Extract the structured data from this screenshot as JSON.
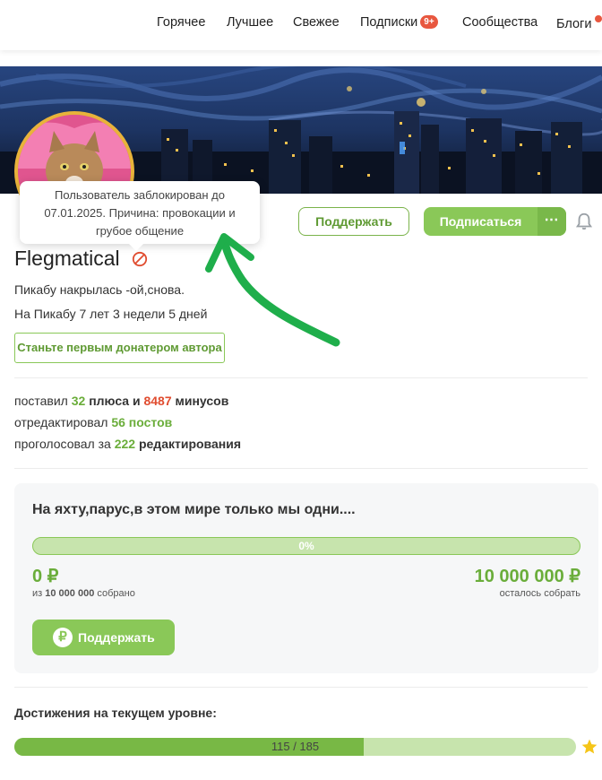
{
  "nav": {
    "items": [
      {
        "label": "Горячее"
      },
      {
        "label": "Лучшее"
      },
      {
        "label": "Свежее"
      },
      {
        "label": "Подписки",
        "badge": "9+"
      },
      {
        "label": "Сообщества"
      },
      {
        "label": "Блоги"
      }
    ],
    "badge_color": "#e8573f"
  },
  "tooltip": {
    "text": "Пользователь заблокирован до 07.01.2025. Причина: провокации и грубое общение"
  },
  "actions": {
    "support_label": "Поддержать",
    "subscribe_label": "Подписаться",
    "more_label": "⋯"
  },
  "profile": {
    "username": "Flegmatical",
    "status": "Пикабу накрылась -ой,снова.",
    "tenure": "На Пикабу 7 лет 3 недели 5 дней",
    "donate_first_label": "Станьте первым донатером автора"
  },
  "stats": {
    "line1": {
      "prefix": "поставил",
      "pluses": "32",
      "mid": "плюса и",
      "minuses": "8487",
      "suffix": "минусов"
    },
    "line2": {
      "prefix": "отредактировал",
      "count": "56",
      "suffix": "постов"
    },
    "line3": {
      "prefix": "проголосовал за",
      "count": "222",
      "suffix": "редактирования"
    }
  },
  "fundraiser": {
    "title": "На яхту,парус,в этом мире только мы одни....",
    "progress_percent": 0,
    "progress_label": "0%",
    "raised": "0 ₽",
    "raised_sub_prefix": "из",
    "raised_sub_goal": "10 000 000",
    "raised_sub_suffix": "собрано",
    "remaining": "10 000 000 ₽",
    "remaining_sub": "осталось собрать",
    "button_label": "Поддержать",
    "button_icon": "₽"
  },
  "achievements": {
    "title": "Достижения на текущем уровне:",
    "current": 115,
    "total": 185,
    "label": "115 / 185"
  },
  "colors": {
    "accent_green": "#8ac858",
    "text_green": "#6aad3a",
    "minus_red": "#e04c2f",
    "arrow_green": "#1fae4b",
    "avatar_ring": "#e8b33a"
  }
}
